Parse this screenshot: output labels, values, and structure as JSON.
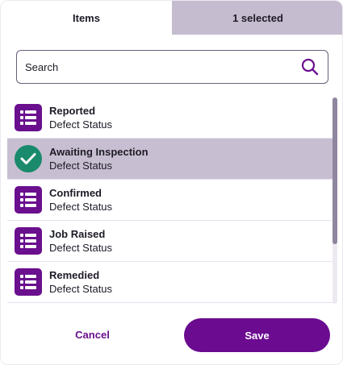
{
  "tabs": [
    {
      "label": "Items"
    },
    {
      "label": "1 selected"
    }
  ],
  "search": {
    "placeholder": "Search",
    "value": "",
    "icon": "search-icon"
  },
  "items": [
    {
      "title": "Reported",
      "subtitle": "Defect Status",
      "icon": "list-icon",
      "selected": false
    },
    {
      "title": "Awaiting Inspection",
      "subtitle": "Defect Status",
      "icon": "checkmark-icon",
      "selected": true
    },
    {
      "title": "Confirmed",
      "subtitle": "Defect Status",
      "icon": "list-icon",
      "selected": false
    },
    {
      "title": "Job Raised",
      "subtitle": "Defect Status",
      "icon": "list-icon",
      "selected": false
    },
    {
      "title": "Remedied",
      "subtitle": "Defect Status",
      "icon": "list-icon",
      "selected": false
    }
  ],
  "footer": {
    "cancel_label": "Cancel",
    "save_label": "Save"
  },
  "colors": {
    "accent": "#6a0b90",
    "selected_row": "#c7bfd1",
    "selected_tab": "#c5bdcf",
    "check_green": "#1a8a6c"
  }
}
